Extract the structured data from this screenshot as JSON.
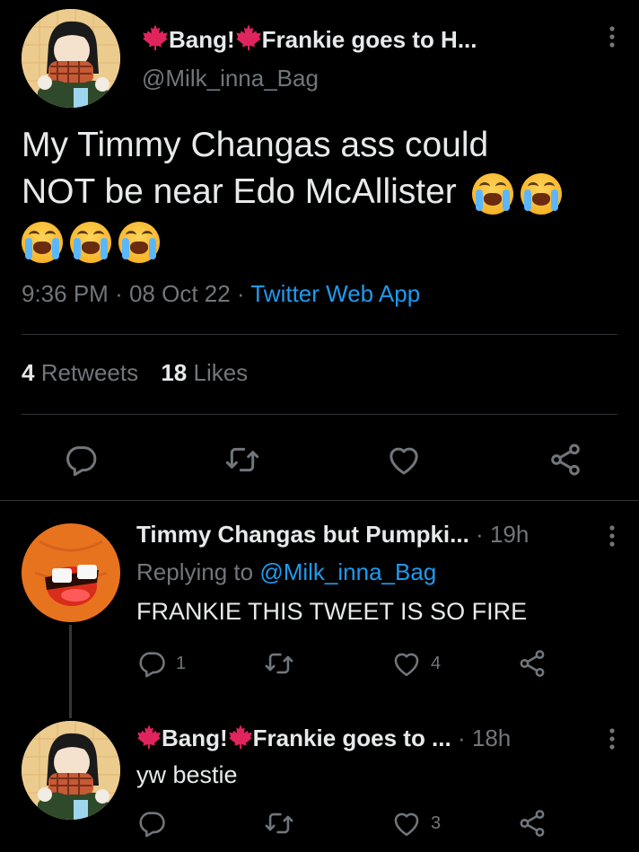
{
  "main_tweet": {
    "display_name": "Bang! Frankie goes to H...",
    "name_part1": "Bang!",
    "name_part2": "Frankie goes to H...",
    "handle": "@Milk_inna_Bag",
    "text_line1": "My Timmy Changas ass could",
    "text_line2": "NOT be near Edo McAllister",
    "time": "9:36 PM",
    "date": "08 Oct 22",
    "source": "Twitter Web App",
    "retweets_count": "4",
    "retweets_label": "Retweets",
    "likes_count": "18",
    "likes_label": "Likes"
  },
  "replies": [
    {
      "display_name": "Timmy Changas but Pumpki...",
      "age": "19h",
      "replying_to_label": "Replying to",
      "replying_to_handle": "@Milk_inna_Bag",
      "text": "FRANKIE THIS TWEET IS SO FIRE",
      "reply_count": "1",
      "like_count": "4"
    },
    {
      "name_part1": "Bang!",
      "name_part2": "Frankie goes to ...",
      "age": "18h",
      "text": "yw bestie",
      "like_count": "3"
    }
  ],
  "icons": {
    "maple_leaf": "maple-leaf-icon",
    "crying_emoji": "loudly-crying-face-emoji",
    "reply": "reply-icon",
    "retweet": "retweet-icon",
    "like": "heart-icon",
    "share": "share-icon",
    "more": "more-dots-icon"
  },
  "colors": {
    "background": "#000000",
    "text": "#e7e9ea",
    "muted": "#71767b",
    "link": "#1d9bf0",
    "divider": "#2f3336",
    "maple_leaf": "#e0245e"
  }
}
